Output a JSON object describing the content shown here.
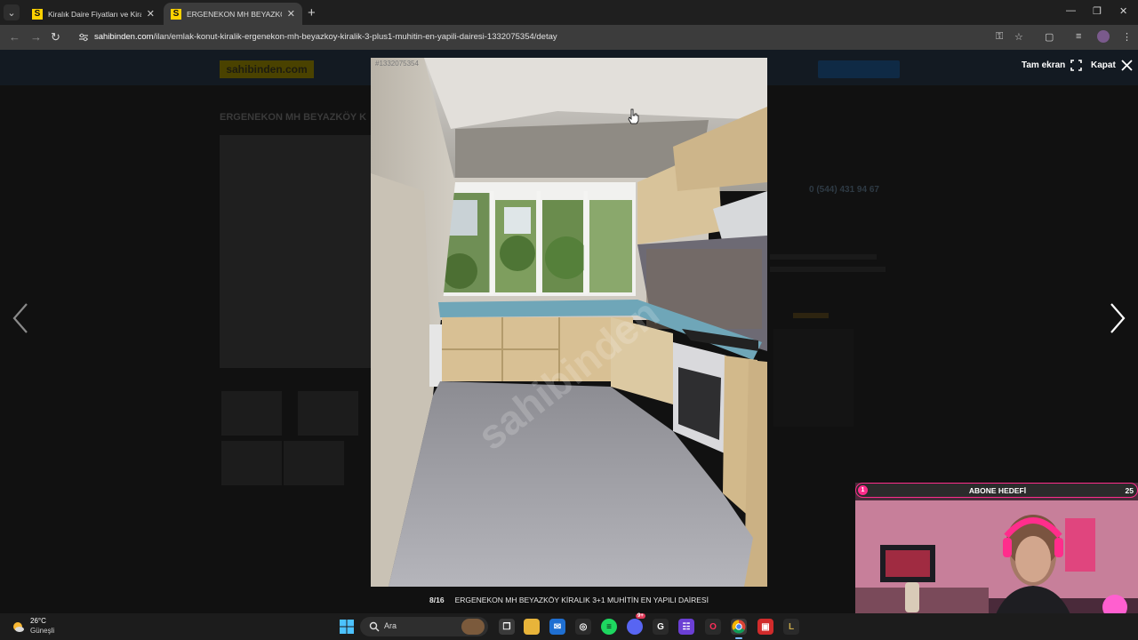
{
  "browser": {
    "tabs": [
      {
        "label": "Kiralık Daire Fiyatları ve Kiralık E",
        "favicon": "S"
      },
      {
        "label": "ERGENEKON MH BEYAZKÖY KİR",
        "favicon": "S"
      }
    ],
    "url_host": "sahibinden.com",
    "url_path": "/ilan/emlak-konut-kiralik-ergenekon-mh-beyazkoy-kiralik-3-plus1-muhitin-en-yapili-dairesi-1332075354/detay"
  },
  "page": {
    "logo": "sahibinden.com",
    "title": "ERGENEKON MH BEYAZKÖY K",
    "phone": "0 (544) 431 94 67"
  },
  "lightbox": {
    "photo_id": "#1332075354",
    "fullscreen_label": "Tam ekran",
    "close_label": "Kapat",
    "counter": "8/16",
    "caption": "ERGENEKON MH BEYAZKÖY KİRALIK 3+1 MUHİTİN EN YAPILI DAİRESİ",
    "watermark": "sahibinden"
  },
  "webcam": {
    "goal_current": "1",
    "goal_title": "ABONE HEDEFİ",
    "goal_target": "25"
  },
  "taskbar": {
    "weather_temp": "26°C",
    "weather_desc": "Güneşli",
    "search_placeholder": "Ara",
    "badge_count": "9+"
  },
  "colors": {
    "brand_yellow": "#ffd200",
    "stream_pink": "#ff2d8c",
    "taskbar_accent": "#7ab8ff"
  }
}
